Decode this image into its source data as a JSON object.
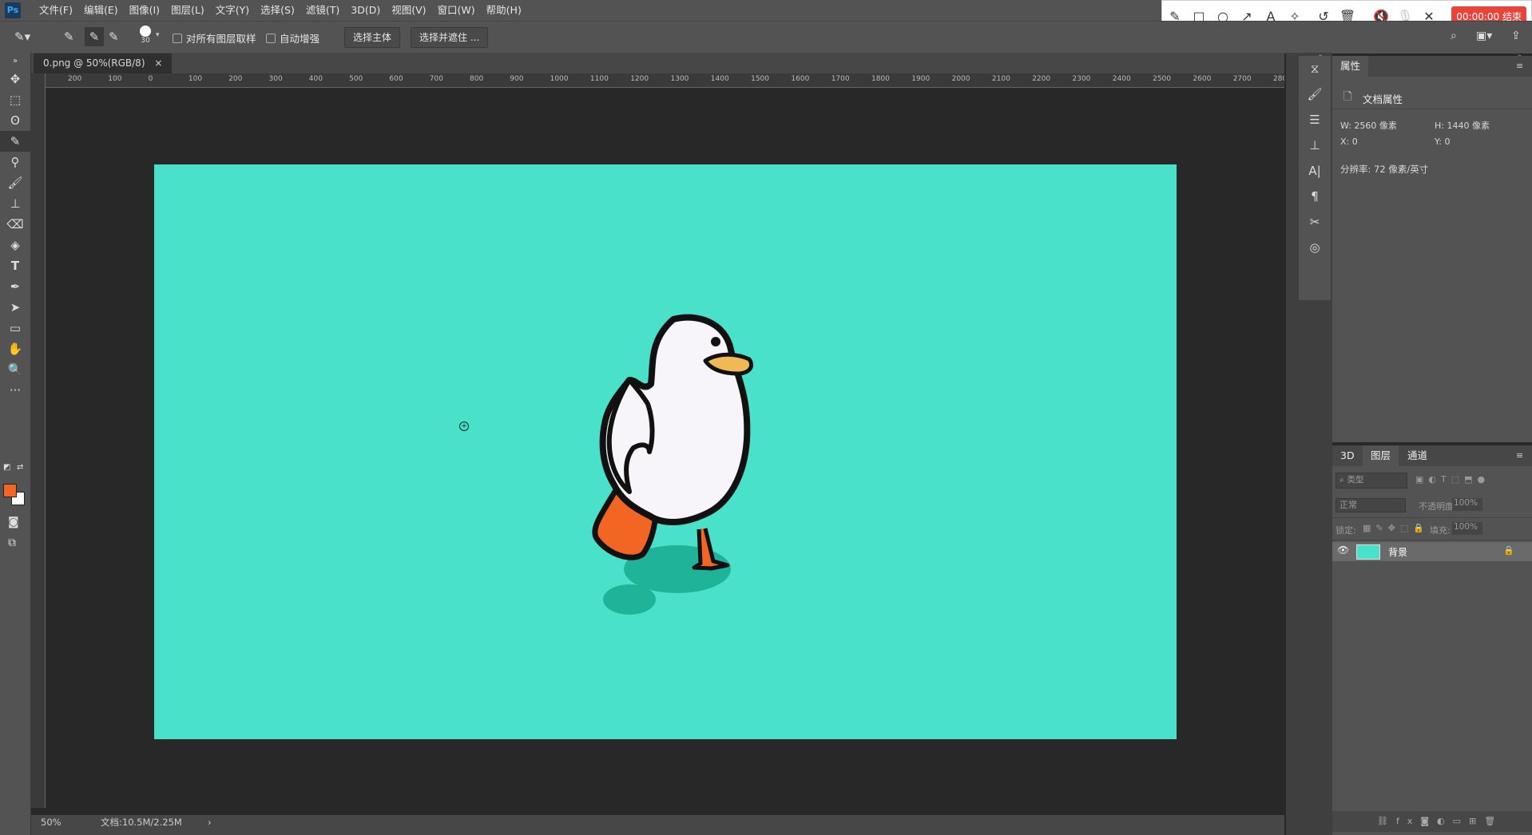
{
  "app": {
    "logo": "Ps"
  },
  "menu": [
    "文件(F)",
    "编辑(E)",
    "图像(I)",
    "图层(L)",
    "文字(Y)",
    "选择(S)",
    "滤镜(T)",
    "3D(D)",
    "视图(V)",
    "窗口(W)",
    "帮助(H)"
  ],
  "recording": {
    "timer": "00:00:00 结束"
  },
  "options": {
    "brush_size": "30",
    "sample_all_layers": "对所有图层取样",
    "auto_enhance": "自动增强",
    "select_subject": "选择主体",
    "select_and_mask": "选择并遮住 ..."
  },
  "document": {
    "tab_title": "0.png @ 50%(RGB/8)",
    "close": "×"
  },
  "ruler": {
    "h_ticks": [
      "200",
      "100",
      "0",
      "100",
      "200",
      "300",
      "400",
      "500",
      "600",
      "700",
      "800",
      "900",
      "1000",
      "1100",
      "1200",
      "1300",
      "1400",
      "1500",
      "1600",
      "1700",
      "1800",
      "1900",
      "2000",
      "2100",
      "2200",
      "2300",
      "2400",
      "2500",
      "2600",
      "2700",
      "280"
    ]
  },
  "status": {
    "zoom": "50%",
    "doc": "文档:10.5M/2.25M",
    "arrow": "›"
  },
  "properties": {
    "tab": "属性",
    "section": "文档属性",
    "w": "W:  2560 像素",
    "h": "H:  1440 像素",
    "x": "X:  0",
    "y": "Y:  0",
    "resolution": "分辨率: 72 像素/英寸"
  },
  "layers": {
    "tabs": [
      "3D",
      "图层",
      "通道"
    ],
    "filter_placeholder": "类型",
    "blend_mode": "正常",
    "opacity_label": "不透明度:",
    "opacity_value": "100%",
    "lock_label": "锁定:",
    "fill_label": "填充:",
    "fill_value": "100%",
    "layer_name": "背景"
  },
  "colors": {
    "canvas": "#49e1c9",
    "foreground": "#f26522",
    "background": "#ffffff",
    "duck_leg": "#f26522",
    "shadow": "#1fb39a"
  }
}
